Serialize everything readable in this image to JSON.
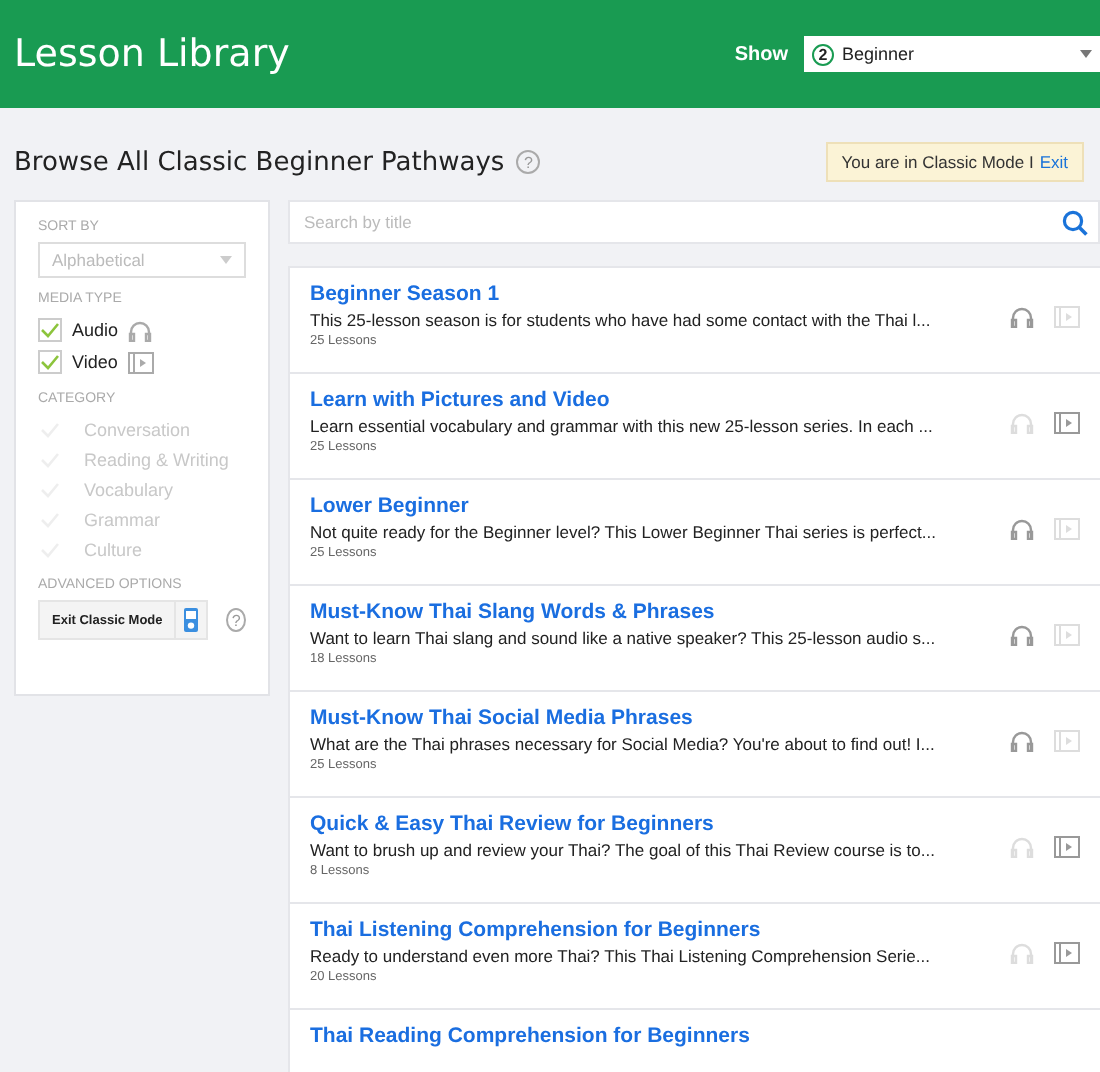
{
  "header": {
    "title": "Lesson Library",
    "show_label": "Show",
    "level_number": "2",
    "level_name": "Beginner"
  },
  "heading": "Browse All Classic Beginner Pathways",
  "help_icon": "?",
  "mode_notice": {
    "text": "You are in Classic Mode I",
    "link": "Exit"
  },
  "sidebar": {
    "sort_label": "SORT BY",
    "sort_value": "Alphabetical",
    "media_label": "MEDIA TYPE",
    "media": [
      {
        "label": "Audio",
        "kind": "audio",
        "checked": true
      },
      {
        "label": "Video",
        "kind": "video",
        "checked": true
      }
    ],
    "category_label": "CATEGORY",
    "categories": [
      {
        "label": "Conversation",
        "checked": false
      },
      {
        "label": "Reading & Writing",
        "checked": false
      },
      {
        "label": "Vocabulary",
        "checked": false
      },
      {
        "label": "Grammar",
        "checked": false
      },
      {
        "label": "Culture",
        "checked": false
      }
    ],
    "advanced_label": "ADVANCED OPTIONS",
    "exit_button": "Exit Classic Mode",
    "help_icon": "?"
  },
  "search": {
    "placeholder": "Search by title"
  },
  "lessons": [
    {
      "title": "Beginner Season 1",
      "description": "This 25-lesson season is for students who have had some contact with the Thai l...",
      "count": "25 Lessons",
      "audio": true,
      "video": false
    },
    {
      "title": "Learn with Pictures and Video",
      "description": "Learn essential vocabulary and grammar with this new 25-lesson series. In each ...",
      "count": "25 Lessons",
      "audio": false,
      "video": true
    },
    {
      "title": "Lower Beginner",
      "description": "Not quite ready for the Beginner level? This Lower Beginner Thai series is perfect...",
      "count": "25 Lessons",
      "audio": true,
      "video": false
    },
    {
      "title": "Must-Know Thai Slang Words & Phrases",
      "description": "Want to learn Thai slang and sound like a native speaker? This 25-lesson audio s...",
      "count": "18 Lessons",
      "audio": true,
      "video": false
    },
    {
      "title": "Must-Know Thai Social Media Phrases",
      "description": "What are the Thai phrases necessary for Social Media? You're about to find out! I...",
      "count": "25 Lessons",
      "audio": true,
      "video": false
    },
    {
      "title": "Quick & Easy Thai Review for Beginners",
      "description": "Want to brush up and review your Thai? The goal of this Thai Review course is to...",
      "count": "8 Lessons",
      "audio": false,
      "video": true
    },
    {
      "title": "Thai Listening Comprehension for Beginners",
      "description": "Ready to understand even more Thai? This Thai Listening Comprehension Serie...",
      "count": "20 Lessons",
      "audio": false,
      "video": true
    },
    {
      "title": "Thai Reading Comprehension for Beginners"
    }
  ]
}
